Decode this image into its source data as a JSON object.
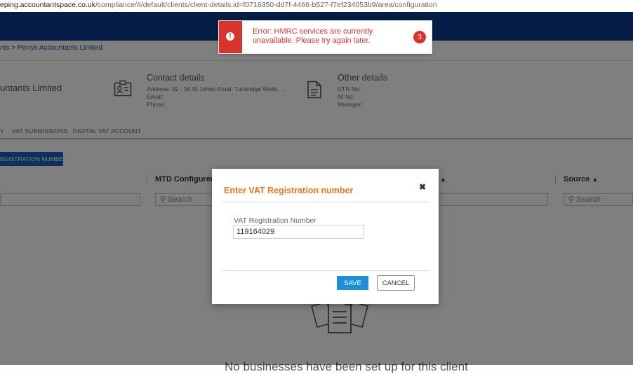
{
  "browser": {
    "url_host": "eping.accountantspace.co.uk",
    "url_path": "/compliance/#/default/clients/client-details:id=f0716350-dd7f-4466-b527-f7ef234053b9/area/configuration"
  },
  "breadcrumb": "nts > Perrys Accountants Limited",
  "client": {
    "name": "untants Limited",
    "contact": {
      "heading": "Contact details",
      "address": "Address: 32 - 34 St Johns Road, Tunbridge Wells, ...",
      "email": "Email:",
      "phone": "Phone:"
    },
    "other": {
      "heading": "Other details",
      "utr": "UTR No:",
      "ni": "NI No:",
      "manager": "Manager:"
    }
  },
  "tabs": [
    {
      "label": "Y"
    },
    {
      "label": "VAT SUBMISSIONS"
    },
    {
      "label": "DIGITAL VAT ACCOUNT"
    }
  ],
  "add_button": "EGISTRATION NUMBER",
  "table": {
    "headers": {
      "mtd": "MTD Configured?",
      "source": "Source"
    },
    "search_placeholder": "Search"
  },
  "empty_text": "No businesses have been set up for this client",
  "toast": {
    "message": "Error: HMRC services are currently unavailable. Please try again later.",
    "count": "3"
  },
  "modal": {
    "title": "Enter VAT Registration number",
    "field_label": "VAT Registration Number",
    "field_value": "119164029",
    "save_label": "SAVE",
    "cancel_label": "CANCEL"
  },
  "icons": {
    "close": "close-icon",
    "search": "search-icon",
    "sort": "sort-icon",
    "error": "error-icon"
  },
  "colors": {
    "topbar": "#0d3d8e",
    "error": "#d9342b",
    "modal_title": "#e07a1f",
    "save": "#1d8fd6"
  }
}
